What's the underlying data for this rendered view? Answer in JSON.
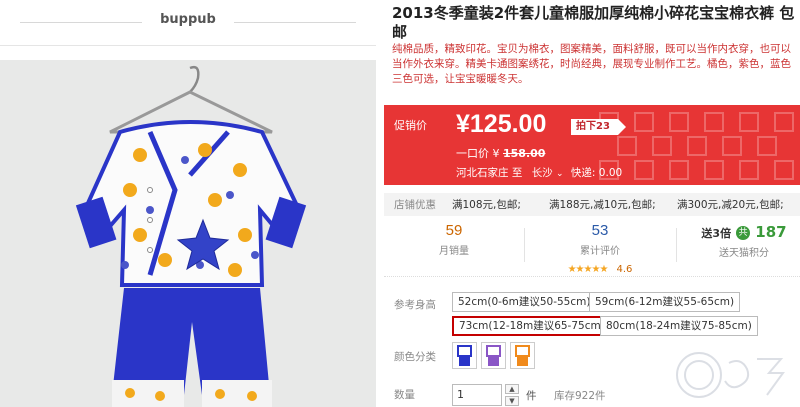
{
  "shop": {
    "name": "buppub"
  },
  "product": {
    "title": "2013冬季童装2件套儿童棉服加厚纯棉小碎花宝宝棉衣裤 包邮",
    "subtitle": "纯棉品质，精致印花。宝贝为棉衣，图案精美，面料舒服，既可以当作内衣穿，也可以当作外衣来穿。精美卡通图案绣花，时尚经典，展现专业制作工艺。橘色，紫色，蓝色三色可选，让宝宝暖暖冬天。"
  },
  "price": {
    "label": "促销价",
    "value": "¥125.00",
    "discount_badge": "拍下23",
    "original_label": "一口价 ¥",
    "original_value": "158.00",
    "origin": "河北石家庄",
    "to": "至",
    "destination": "长沙",
    "caret": "⌄",
    "shipping": "快递: 0.00"
  },
  "promo": {
    "label": "店铺优惠",
    "items": [
      "满108元,包邮;",
      "满188元,减10元,包邮;",
      "满300元,减20元,包邮;"
    ]
  },
  "stats": {
    "monthly_sales": "59",
    "monthly_sales_label": "月销量",
    "reviews": "53",
    "reviews_label": "累计评价",
    "stars": "★★★★★",
    "rating": "4.6",
    "gift_prefix": "送3倍",
    "gift_badge": "共",
    "points": "187",
    "points_label": "送天猫积分"
  },
  "options": {
    "size_label": "参考身高",
    "sizes": [
      "52cm(0-6m建议50-55cm)",
      "59cm(6-12m建议55-65cm)",
      "73cm(12-18m建议65-75cm)",
      "80cm(18-24m建议75-85cm)"
    ],
    "selected_size_index": 2,
    "color_label": "颜色分类",
    "colors": [
      "blue",
      "purple",
      "orange"
    ]
  },
  "quantity": {
    "label": "数量",
    "value": "1",
    "up": "▲",
    "down": "▼",
    "unit": "件",
    "stock": "库存922件"
  },
  "colors": {
    "price_red": "#e73535",
    "selected_border": "#c40000",
    "accent_orange": "#cc6600",
    "blue_text": "#2b5aa8"
  }
}
